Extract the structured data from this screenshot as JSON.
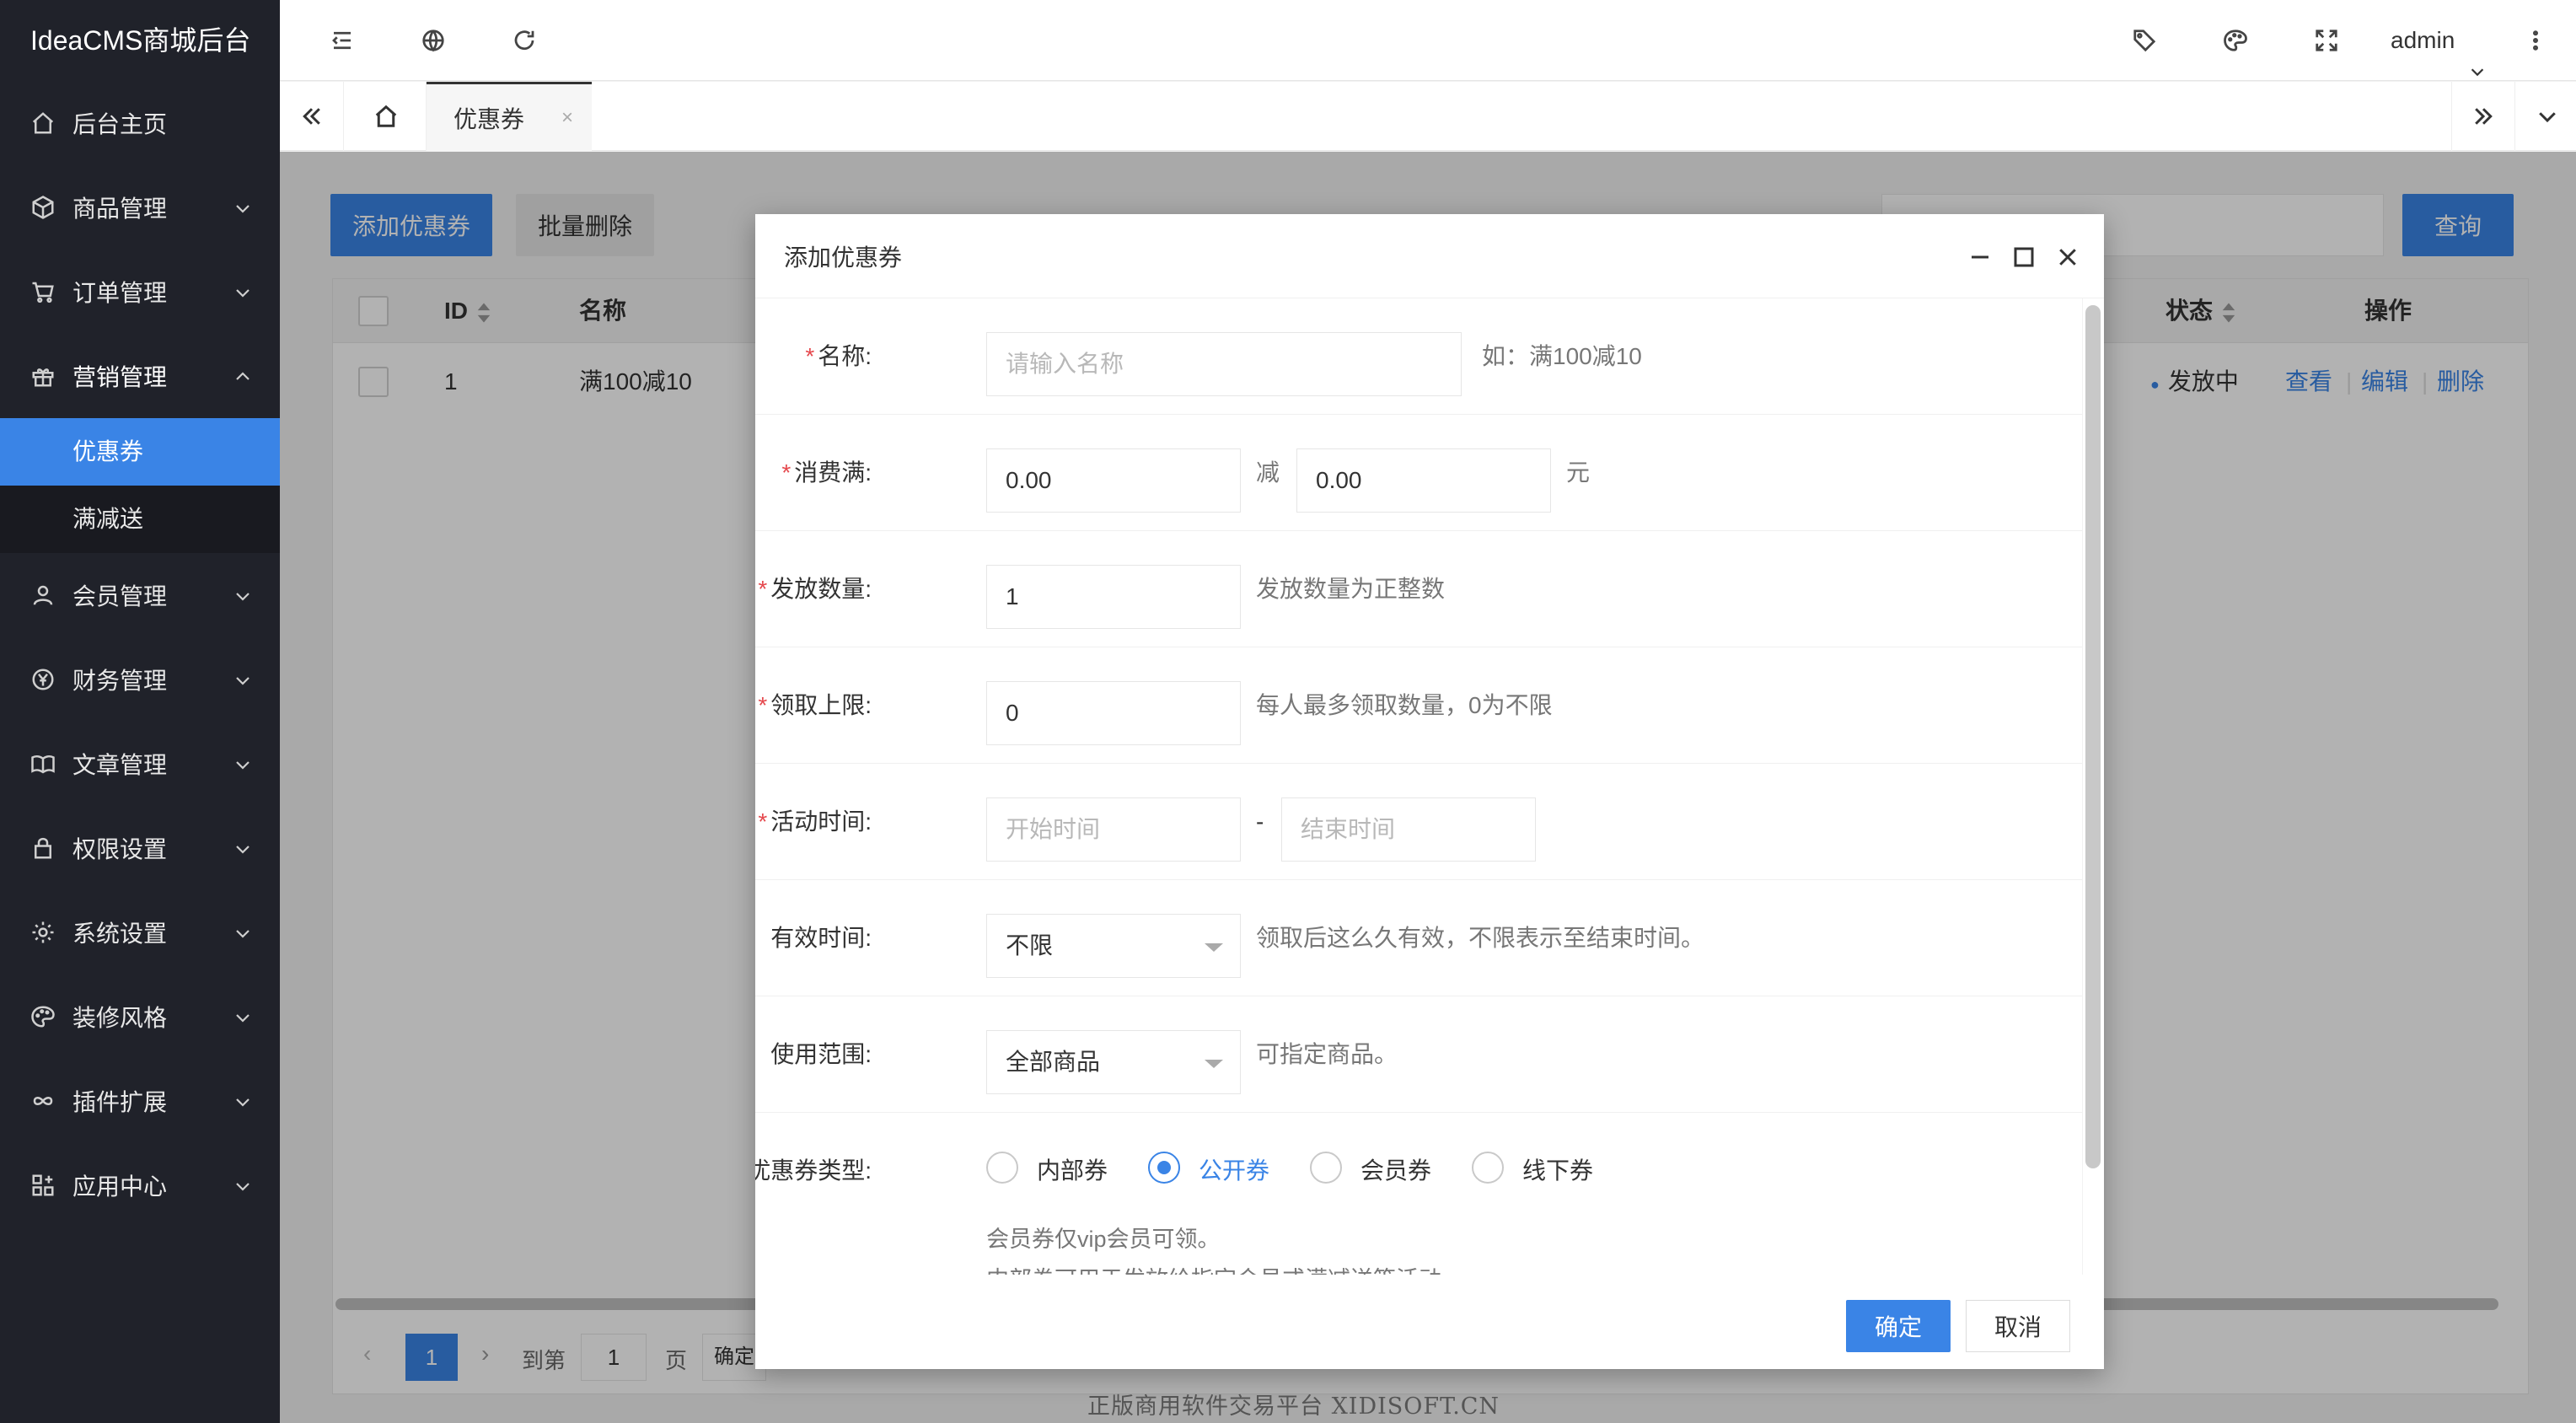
{
  "app": {
    "title": "IdeaCMS商城后台"
  },
  "sidebar": {
    "items": [
      {
        "label": "后台主页",
        "icon": "home-icon"
      },
      {
        "label": "商品管理",
        "icon": "box-icon"
      },
      {
        "label": "订单管理",
        "icon": "cart-icon"
      },
      {
        "label": "营销管理",
        "icon": "gift-icon",
        "expanded": true
      },
      {
        "label": "会员管理",
        "icon": "user-icon"
      },
      {
        "label": "财务管理",
        "icon": "yen-icon"
      },
      {
        "label": "文章管理",
        "icon": "book-icon"
      },
      {
        "label": "权限设置",
        "icon": "lock-icon"
      },
      {
        "label": "系统设置",
        "icon": "gear-icon"
      },
      {
        "label": "装修风格",
        "icon": "palette-icon"
      },
      {
        "label": "插件扩展",
        "icon": "infinity-icon"
      },
      {
        "label": "应用中心",
        "icon": "apps-icon"
      }
    ],
    "sub_items": [
      {
        "label": "优惠券",
        "active": true
      },
      {
        "label": "满减送",
        "active": false
      }
    ]
  },
  "header": {
    "user": "admin"
  },
  "tabs": {
    "current": "优惠券",
    "close": "×"
  },
  "toolbar": {
    "add_label": "添加优惠券",
    "batch_delete_label": "批量删除",
    "search_label": "查询"
  },
  "table": {
    "columns": {
      "id": "ID",
      "name": "名称",
      "status": "状态",
      "actions": "操作"
    },
    "rows": [
      {
        "id": "1",
        "name": "满100减10",
        "status": "发放中",
        "view": "查看",
        "edit": "编辑",
        "delete": "删除"
      }
    ]
  },
  "pager": {
    "current": "1",
    "goto_label": "到第",
    "goto_value": "1",
    "page_unit": "页",
    "confirm": "确定"
  },
  "modal": {
    "title": "添加优惠券",
    "fields": {
      "name": {
        "label": "名称:",
        "placeholder": "请输入名称",
        "hint": "如：满100减10"
      },
      "threshold": {
        "label": "消费满:",
        "value1": "0.00",
        "minus": "减",
        "value2": "0.00",
        "unit": "元"
      },
      "quantity": {
        "label": "发放数量:",
        "value": "1",
        "hint": "发放数量为正整数"
      },
      "limit": {
        "label": "领取上限:",
        "value": "0",
        "hint": "每人最多领取数量，0为不限"
      },
      "activity_time": {
        "label": "活动时间:",
        "start_placeholder": "开始时间",
        "dash": "-",
        "end_placeholder": "结束时间"
      },
      "valid_time": {
        "label": "有效时间:",
        "value": "不限",
        "hint": "领取后这么久有效，不限表示至结束时间。"
      },
      "scope": {
        "label": "使用范围:",
        "value": "全部商品",
        "hint": "可指定商品。"
      },
      "type": {
        "label": "优惠券类型:",
        "options": [
          {
            "label": "内部券",
            "checked": false
          },
          {
            "label": "公开券",
            "checked": true
          },
          {
            "label": "会员券",
            "checked": false
          },
          {
            "label": "线下券",
            "checked": false
          }
        ],
        "note1": "会员券仅vip会员可领。",
        "note2": "内部券可用于发放给指定会员或满减送等活动"
      }
    },
    "ok_label": "确定",
    "cancel_label": "取消"
  },
  "watermark": "正版商用软件交易平台 XIDISOFT.CN",
  "colors": {
    "accent": "#3a84e6",
    "sidebar": "#20222a",
    "required": "#e5484d"
  }
}
